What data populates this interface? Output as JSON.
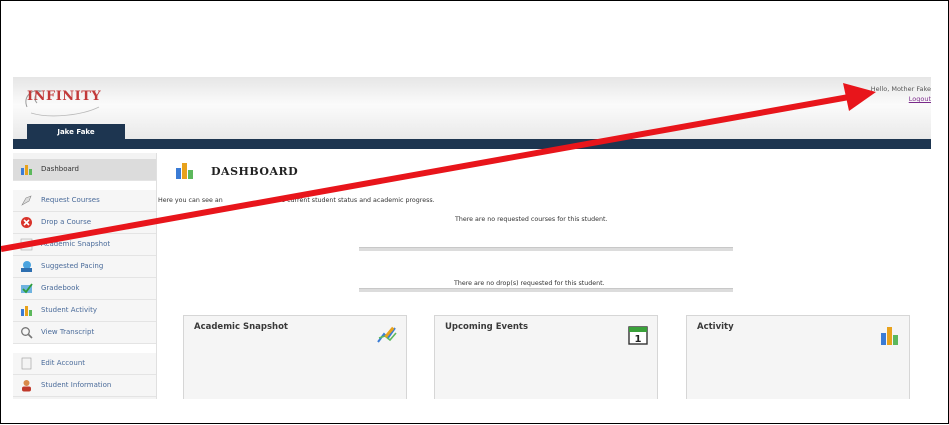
{
  "header": {
    "logo_text": "INFINITY",
    "greeting": "Hello, Mother Fake",
    "logout_label": "Logout",
    "student_tab": "Jake Fake"
  },
  "sidebar": {
    "items": [
      {
        "label": "Dashboard",
        "icon": "dashboard-icon"
      },
      {
        "label": "Request Courses",
        "icon": "request-courses-icon"
      },
      {
        "label": "Drop a Course",
        "icon": "drop-course-icon"
      },
      {
        "label": "Academic Snapshot",
        "icon": "academic-snapshot-icon"
      },
      {
        "label": "Suggested Pacing",
        "icon": "suggested-pacing-icon"
      },
      {
        "label": "Gradebook",
        "icon": "gradebook-icon"
      },
      {
        "label": "Student Activity",
        "icon": "student-activity-icon"
      },
      {
        "label": "View Transcript",
        "icon": "view-transcript-icon"
      },
      {
        "label": "Edit Account",
        "icon": "edit-account-icon"
      },
      {
        "label": "Student Information",
        "icon": "student-information-icon"
      }
    ]
  },
  "main": {
    "title": "DASHBOARD",
    "intro_before": "Here you can see an",
    "intro_after": "the current student status and academic progress.",
    "no_requests": "There are no requested courses for this student.",
    "no_drops": "There are no drop(s) requested for this student.",
    "cards": [
      {
        "title": "Academic Snapshot",
        "icon": "chart-pencil-icon"
      },
      {
        "title": "Upcoming Events",
        "icon": "calendar-icon",
        "calendar_day": "1"
      },
      {
        "title": "Activity",
        "icon": "bar-chart-icon"
      }
    ]
  },
  "annotation": {
    "color": "#e8151b",
    "type": "red-arrow"
  }
}
